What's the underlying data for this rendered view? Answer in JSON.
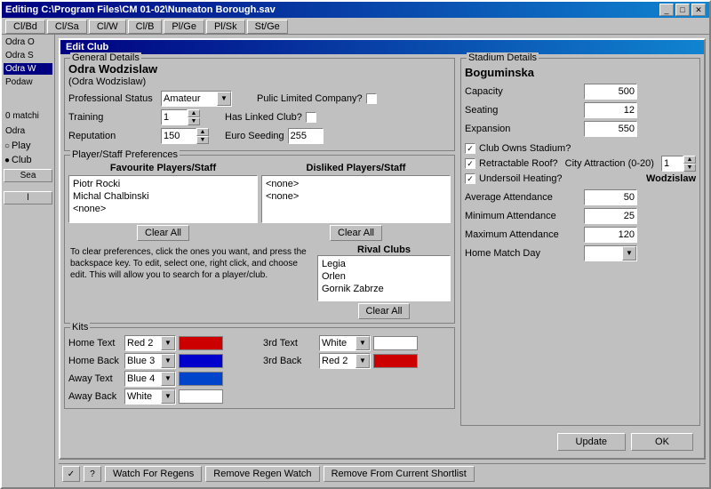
{
  "window": {
    "title": "Editing C:\\Program Files\\CM 01-02\\Nuneaton Borough.sav",
    "title_buttons": [
      "_",
      "□",
      "✕"
    ]
  },
  "tabs": [
    "Cl/Bd",
    "Cl/Sa",
    "Cl/W",
    "Cl/B",
    "Pl/Ge",
    "Pl/Sk",
    "St/Ge"
  ],
  "sidebar": {
    "items": [
      "Odra O",
      "Odra S",
      "Odra W",
      "Podaw"
    ],
    "selected": 2,
    "status": "0 matchi",
    "search_label": "Odra",
    "radio_options": [
      "Play",
      "Club"
    ],
    "selected_radio": "Club",
    "search_btn": "Sea"
  },
  "dialog": {
    "title": "Edit Club",
    "general_details": {
      "label": "General Details",
      "club_name": "Odra Wodzislaw",
      "club_name_alt": "(Odra Wodzislaw)",
      "professional_status_label": "Professional Status",
      "professional_status": "Amateur",
      "plc_label": "Pulic Limited Company?",
      "plc_checked": false,
      "training_label": "Training",
      "training_value": "1",
      "linked_club_label": "Has Linked Club?",
      "linked_club_checked": false,
      "reputation_label": "Reputation",
      "reputation_value": "150",
      "euro_seeding_label": "Euro Seeding",
      "euro_seeding_value": "255"
    },
    "preferences": {
      "label": "Player/Staff Preferences",
      "favourite_header": "Favourite Players/Staff",
      "favourite_items": [
        "Piotr Rocki",
        "Michal Chalbinski",
        "<none>"
      ],
      "disliked_header": "Disliked Players/Staff",
      "disliked_items": [
        "<none>",
        "<none>"
      ],
      "clear_all_label": "Clear All",
      "help_text": "To clear preferences, click the ones you want, and press the backspace key. To edit, select one, right click, and choose edit. This will allow you to search for a player/club.",
      "rival_header": "Rival Clubs",
      "rival_items": [
        "Legia",
        "Orlen",
        "Gornik Zabrze"
      ],
      "rival_clear_btn": "Clear All"
    },
    "kits": {
      "label": "Kits",
      "rows": [
        {
          "label": "Home Text",
          "color_name": "Red 2",
          "color_hex": "#cc0000",
          "swatch_hex": "#cc0000"
        },
        {
          "label": "Home Back",
          "color_name": "Blue 3",
          "color_hex": "#0000cc",
          "swatch_hex": "#0000cc"
        },
        {
          "label": "Away Text",
          "color_name": "Blue 4",
          "color_hex": "#0044cc",
          "swatch_hex": "#0044cc"
        },
        {
          "label": "Away Back",
          "color_name": "White",
          "color_hex": "#ffffff",
          "swatch_hex": "#ffffff"
        }
      ],
      "rows_right": [
        {
          "label": "3rd Text",
          "color_name": "White",
          "color_hex": "#ffffff",
          "swatch_hex": "#ffffff"
        },
        {
          "label": "3rd Back",
          "color_name": "Red 2",
          "color_hex": "#cc0000",
          "swatch_hex": "#cc0000"
        }
      ]
    },
    "stadium": {
      "label": "Stadium Details",
      "name": "Boguminska",
      "capacity_label": "Capacity",
      "capacity_value": "500",
      "seating_label": "Seating",
      "seating_value": "12",
      "expansion_label": "Expansion",
      "expansion_value": "550",
      "owns_stadium_label": "Club Owns Stadium?",
      "owns_stadium_checked": true,
      "retractable_label": "Retractable Roof?",
      "retractable_checked": true,
      "undersoil_label": "Undersoil Heating?",
      "undersoil_checked": true,
      "city_attraction_label": "City Attraction (0-20)",
      "city_attraction_value": "1",
      "stadium_name_label": "Wodzislaw",
      "avg_attendance_label": "Average Attendance",
      "avg_attendance_value": "50",
      "min_attendance_label": "Minimum Attendance",
      "min_attendance_value": "25",
      "max_attendance_label": "Maximum Attendance",
      "max_attendance_value": "120",
      "home_match_day_label": "Home Match Day",
      "home_match_day_value": ""
    },
    "footer": {
      "update_btn": "Update",
      "ok_btn": "OK"
    }
  },
  "bottom_bar": {
    "icon1": "?",
    "icon2": "✓",
    "watch_regens_btn": "Watch For Regens",
    "remove_regen_btn": "Remove Regen Watch",
    "remove_shortlist_btn": "Remove From Current Shortlist"
  }
}
